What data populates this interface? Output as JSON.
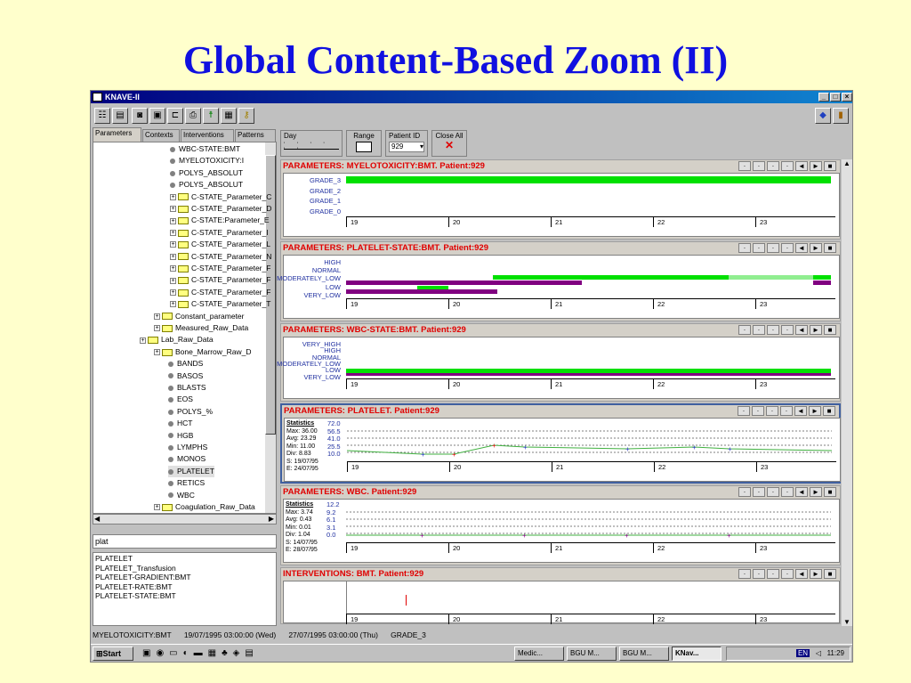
{
  "slide_title": "Global Content-Based Zoom (II)",
  "window": {
    "title": "KNAVE-II",
    "min": "_",
    "max": "□",
    "close": "×"
  },
  "tabs": [
    "Parameters",
    "Contexts",
    "Interventions",
    "Patterns"
  ],
  "tree": [
    {
      "label": "WBC-STATE:BMT",
      "indent": 0,
      "kind": "leaf"
    },
    {
      "label": "MYELOTOXICITY:I",
      "indent": 0,
      "kind": "leaf"
    },
    {
      "label": "POLYS_ABSOLUT",
      "indent": 0,
      "kind": "leaf"
    },
    {
      "label": "POLYS_ABSOLUT",
      "indent": 0,
      "kind": "leaf"
    },
    {
      "label": "C-STATE_Parameter_C",
      "indent": 0,
      "kind": "folder"
    },
    {
      "label": "C-STATE_Parameter_D",
      "indent": 0,
      "kind": "folder"
    },
    {
      "label": "C-STATE:Parameter_E",
      "indent": 0,
      "kind": "folder"
    },
    {
      "label": "C-STATE_Parameter_I",
      "indent": 0,
      "kind": "folder"
    },
    {
      "label": "C-STATE_Parameter_L",
      "indent": 0,
      "kind": "folder"
    },
    {
      "label": "C-STATE_Parameter_N",
      "indent": 0,
      "kind": "folder"
    },
    {
      "label": "C-STATE_Parameter_F",
      "indent": 0,
      "kind": "folder"
    },
    {
      "label": "C-STATE_Parameter_F",
      "indent": 0,
      "kind": "folder"
    },
    {
      "label": "C-STATE_Parameter_F",
      "indent": 0,
      "kind": "folder"
    },
    {
      "label": "C-STATE_Parameter_T",
      "indent": 0,
      "kind": "folder"
    },
    {
      "label": "Constant_parameter",
      "indent": 1,
      "kind": "folder"
    },
    {
      "label": "Measured_Raw_Data",
      "indent": 1,
      "kind": "folder"
    },
    {
      "label": "Lab_Raw_Data",
      "indent": 2,
      "kind": "folder"
    },
    {
      "label": "Bone_Marrow_Raw_D",
      "indent": 3,
      "kind": "folder"
    },
    {
      "label": "BANDS",
      "indent": 4,
      "kind": "leaf"
    },
    {
      "label": "BASOS",
      "indent": 4,
      "kind": "leaf"
    },
    {
      "label": "BLASTS",
      "indent": 4,
      "kind": "leaf"
    },
    {
      "label": "EOS",
      "indent": 4,
      "kind": "leaf"
    },
    {
      "label": "POLYS_%",
      "indent": 4,
      "kind": "leaf"
    },
    {
      "label": "HCT",
      "indent": 4,
      "kind": "leaf"
    },
    {
      "label": "HGB",
      "indent": 4,
      "kind": "leaf"
    },
    {
      "label": "LYMPHS",
      "indent": 4,
      "kind": "leaf"
    },
    {
      "label": "MONOS",
      "indent": 4,
      "kind": "leaf"
    },
    {
      "label": "PLATELET",
      "indent": 4,
      "kind": "leaf",
      "selected": true
    },
    {
      "label": "RETICS",
      "indent": 4,
      "kind": "leaf"
    },
    {
      "label": "WBC",
      "indent": 4,
      "kind": "leaf"
    },
    {
      "label": "Coagulation_Raw_Data",
      "indent": 3,
      "kind": "folder"
    }
  ],
  "search": {
    "value": "plat"
  },
  "results": [
    "PLATELET",
    "PLATELET_Transfusion",
    "PLATELET-GRADIENT:BMT",
    "PLATELET-RATE:BMT",
    "PLATELET-STATE:BMT"
  ],
  "controls": {
    "day": "Day",
    "range": "Range",
    "patient_id_label": "Patient ID",
    "patient_id": "929",
    "close_all": "Close All"
  },
  "icons": {
    "close_all": "red-x-icon"
  },
  "days": [
    "19",
    "20",
    "21",
    "22",
    "23"
  ],
  "panels": [
    {
      "title": "PARAMETERS: MYELOTOXICITY:BMT. Patient:929",
      "levels": [
        "GRADE_3",
        "GRADE_2",
        "GRADE_1",
        "GRADE_0"
      ]
    },
    {
      "title": "PARAMETERS: PLATELET-STATE:BMT. Patient:929",
      "levels": [
        "HIGH",
        "NORMAL",
        "MODERATELY_LOW",
        "LOW",
        "VERY_LOW"
      ]
    },
    {
      "title": "PARAMETERS: WBC-STATE:BMT. Patient:929",
      "levels": [
        "VERY_HIGH",
        "HIGH",
        "NORMAL",
        "MODERATELY_LOW",
        "LOW",
        "VERY_LOW"
      ]
    },
    {
      "title": "PARAMETERS: PLATELET. Patient:929",
      "stats_title": "Statistics",
      "stats": [
        "Max: 36.00",
        "Avg: 23.29",
        "Min: 11.00",
        "Div: 8.83",
        "S: 19/07/95",
        "E: 24/07/95"
      ],
      "yticks": [
        "72.0",
        "56.5",
        "41.0",
        "25.5",
        "10.0"
      ]
    },
    {
      "title": "PARAMETERS: WBC. Patient:929",
      "stats_title": "Statistics",
      "stats": [
        "Max: 3.74",
        "Avg: 0.43",
        "Min: 0.01",
        "Div: 1.04",
        "S: 14/07/95",
        "E: 28/07/95"
      ],
      "yticks": [
        "12.2",
        "9.2",
        "6.1",
        "3.1",
        "0.0"
      ]
    },
    {
      "title": "INTERVENTIONS: BMT. Patient:929"
    }
  ],
  "status": {
    "param": "MYELOTOXICITY:BMT",
    "start": "19/07/1995 03:00:00 (Wed)",
    "end": "27/07/1995 03:00:00 (Thu)",
    "value": "GRADE_3"
  },
  "taskbar": {
    "start": "Start",
    "tasks": [
      "Medic...",
      "BGU M...",
      "BGU M...",
      "KNav..."
    ],
    "tray_lang": "EN",
    "clock": "11:29"
  },
  "colors": {
    "title_blue": "#1010e0",
    "panel_title_red": "#e00000",
    "bar_green": "#00e000",
    "bar_purple": "#800080",
    "line_green": "#40b040"
  }
}
